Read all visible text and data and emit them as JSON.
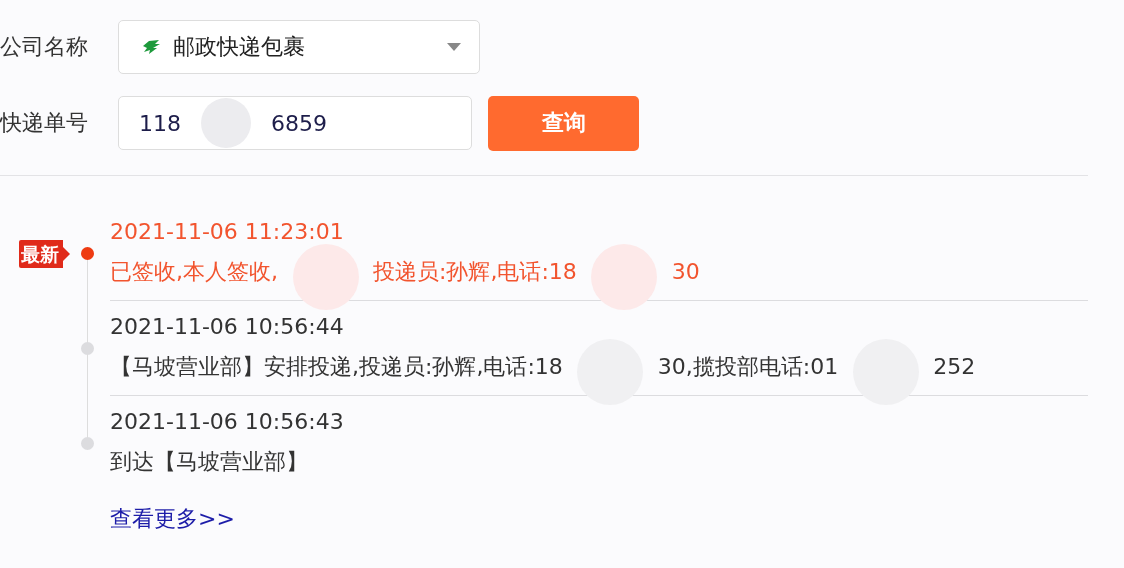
{
  "form": {
    "company_label": "公司名称",
    "company_select": {
      "value": "邮政快递包裹"
    },
    "number_label": "快递单号",
    "number_field": {
      "value_parts": [
        "118",
        "6859"
      ]
    },
    "query_button": "查询"
  },
  "timeline": {
    "latest_badge": "最新",
    "events": [
      {
        "latest": true,
        "time": "2021-11-06 11:23:01",
        "message_parts": [
          "已签收,本人签收,",
          "投递员:孙辉,电话:18",
          "30"
        ]
      },
      {
        "latest": false,
        "time": "2021-11-06 10:56:44",
        "message_parts": [
          "【马坡营业部】安排投递,投递员:孙辉,电话:18",
          "30,揽投部电话:01",
          "252"
        ]
      },
      {
        "latest": false,
        "time": "2021-11-06 10:56:43",
        "message_parts": [
          "到达【马坡营业部】"
        ]
      }
    ]
  },
  "more_link": "查看更多>>"
}
